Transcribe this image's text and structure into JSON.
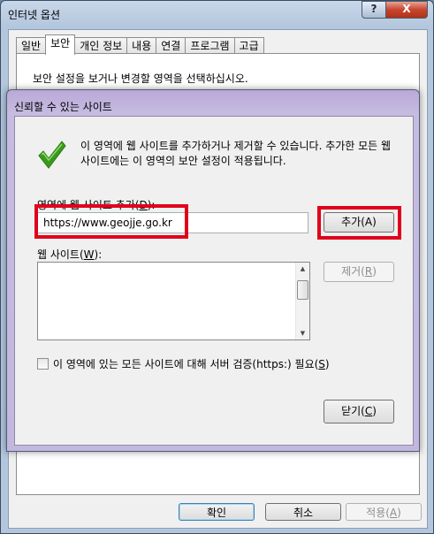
{
  "outer_window": {
    "title": "인터넷 옵션",
    "help_label": "?",
    "close_label": "X",
    "tabs": [
      "일반",
      "보안",
      "개인 정보",
      "내용",
      "연결",
      "프로그램",
      "고급"
    ],
    "active_tab": "보안",
    "panel_description": "보안 설정을 보거나 변경할 영역을 선택하십시오.",
    "buttons": {
      "ok": {
        "text": "확인",
        "mnemonic": ""
      },
      "cancel": {
        "text": "취소",
        "mnemonic": ""
      },
      "apply": {
        "text": "적용(",
        "mnemonic": "A",
        "suffix": ")"
      }
    }
  },
  "dialog": {
    "title": "신뢰할 수 있는 사이트",
    "info_text": "이 영역에 웹 사이트를 추가하거나 제거할 수 있습니다. 추가한 모든 웹 사이트에는 이 영역의 보안 설정이 적용됩니다.",
    "add_label": {
      "prefix": "영역에 웹 사이트 추가(",
      "mnemonic": "D",
      "suffix": "):"
    },
    "url_value": "https://www.geojje.go.kr",
    "add_button": "추가(A)",
    "sites_label": {
      "prefix": "웹 사이트(",
      "mnemonic": "W",
      "suffix": "):"
    },
    "sites": [],
    "remove_button": {
      "prefix": "제거(",
      "mnemonic": "R",
      "suffix": ")"
    },
    "https_checkbox": {
      "label_prefix": "이 영역에 있는 모든 사이트에 대해 서버 검증(https:) 필요(",
      "mnemonic": "S",
      "label_suffix": ")",
      "checked": false
    },
    "close_button": {
      "prefix": "닫기(",
      "mnemonic": "C",
      "suffix": ")"
    }
  },
  "colors": {
    "highlight": "#e1001b",
    "check_icon": "#3a9a1e",
    "dialog_frame": "#c3b7df",
    "outer_frame": "#b3c6dd"
  },
  "icons": {
    "dialog": "green-checkmark-icon"
  }
}
